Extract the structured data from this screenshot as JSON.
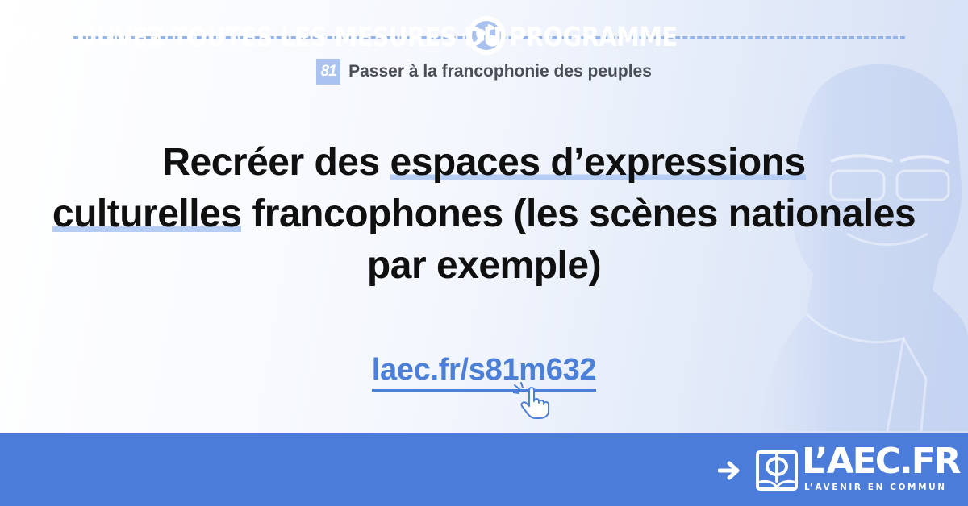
{
  "chapter": {
    "number": "81",
    "title": "Passer à la francophonie des peuples"
  },
  "headline": {
    "part1": "Recréer des ",
    "highlight1": "espaces d’expressions",
    "highlight2": "culturelles",
    "part2": " francophones (les scènes nationales par exemple)"
  },
  "link": {
    "text": "laec.fr/s81m632"
  },
  "footer": {
    "cta": "RETROUVEZ TOUTES LES MESURES DU PROGRAMME",
    "brand": "L’AEC.FR",
    "tagline": "L’AVENIR EN COMMUN"
  },
  "icons": {
    "globe": "globe-icon",
    "hand": "pointing-hand-icon",
    "arrow": "arrow-right-icon",
    "logo": "phi-book-logo"
  },
  "colors": {
    "accent": "#4b7cd9",
    "highlight": "#b6cdf3",
    "link": "#4c7fd8"
  }
}
